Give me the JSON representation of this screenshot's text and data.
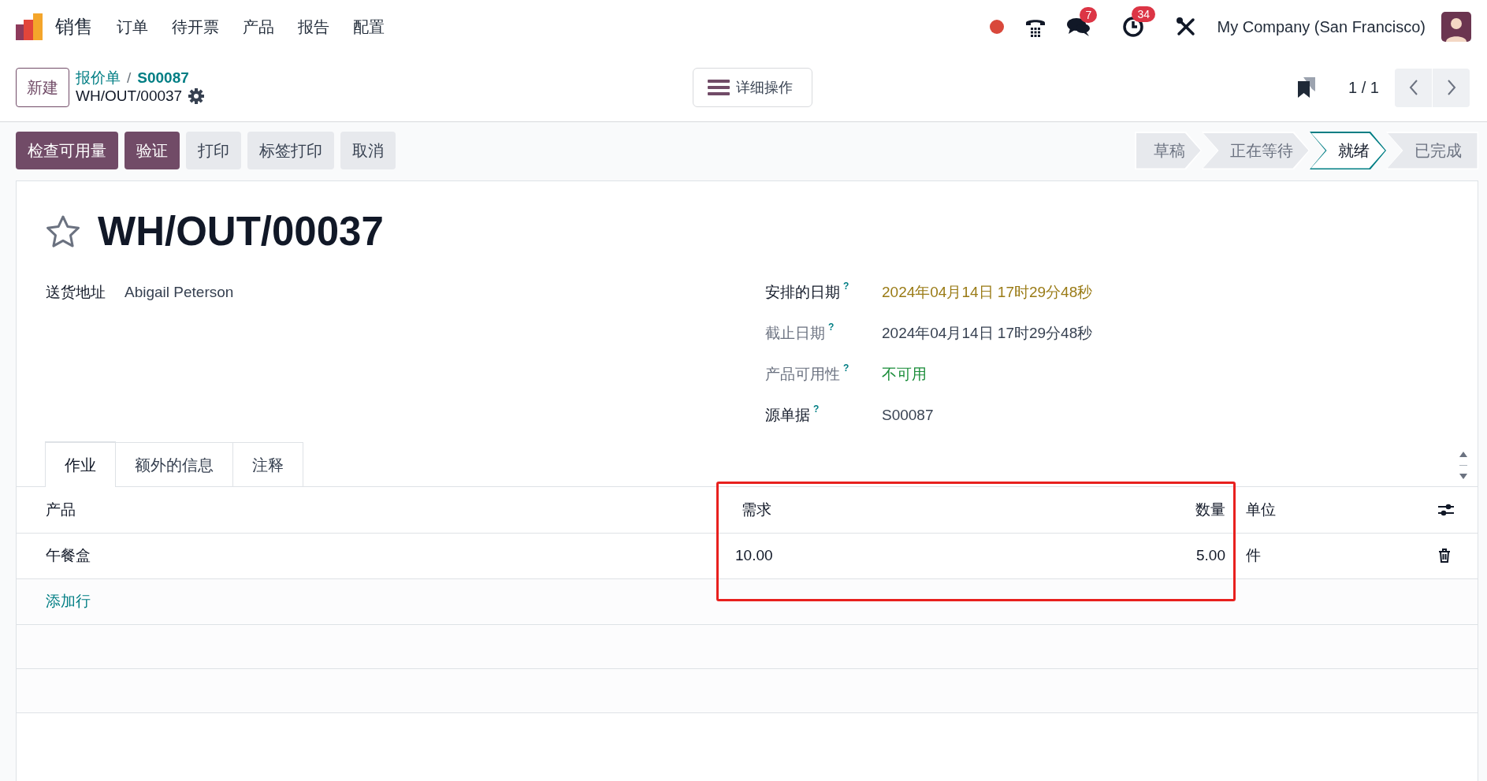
{
  "navbar": {
    "app": "销售",
    "menu": [
      "订单",
      "待开票",
      "产品",
      "报告",
      "配置"
    ],
    "chat_count": "7",
    "activity_count": "34",
    "company": "My Company (San Francisco)"
  },
  "control_panel": {
    "new_button": "新建",
    "breadcrumb": [
      "报价单",
      "S00087"
    ],
    "separator": "/",
    "record": "WH/OUT/00037",
    "actions_button": "详细操作",
    "pager": "1 / 1"
  },
  "buttons": [
    {
      "label": "检查可用量",
      "kind": "primary"
    },
    {
      "label": "验证",
      "kind": "primary"
    },
    {
      "label": "打印",
      "kind": "secondary"
    },
    {
      "label": "标签打印",
      "kind": "secondary"
    },
    {
      "label": "取消",
      "kind": "secondary"
    }
  ],
  "statusbar": [
    {
      "label": "草稿",
      "selected": false
    },
    {
      "label": "正在等待",
      "selected": false
    },
    {
      "label": "就绪",
      "selected": true
    },
    {
      "label": "已完成",
      "selected": false
    }
  ],
  "form": {
    "title": "WH/OUT/00037",
    "starred": false,
    "left_fields": [
      {
        "label": "送货地址",
        "value": "Abigail Peterson"
      }
    ],
    "right_fields": [
      {
        "label": "安排的日期",
        "help": "?",
        "muted": false,
        "value": "2024年04月14日 17时29分48秒",
        "kind": "warning"
      },
      {
        "label": "截止日期",
        "help": "?",
        "muted": true,
        "value": "2024年04月14日 17时29分48秒",
        "kind": "plain"
      },
      {
        "label": "产品可用性",
        "help": "?",
        "muted": true,
        "value": "不可用",
        "kind": "success"
      },
      {
        "label": "源单据",
        "help": "?",
        "muted": false,
        "value": "S00087",
        "kind": "plain"
      }
    ]
  },
  "tabs": [
    {
      "label": "作业",
      "selected": true
    },
    {
      "label": "额外的信息",
      "selected": false
    },
    {
      "label": "注释",
      "selected": false
    }
  ],
  "table": {
    "columns": [
      {
        "label": "产品",
        "highlighted": false
      },
      {
        "label": "需求",
        "highlighted": true
      },
      {
        "label": "数量",
        "highlighted": true
      },
      {
        "label": "单位",
        "highlighted": false
      }
    ],
    "rows": [
      [
        "午餐盒",
        "10.00",
        "5.00",
        "件"
      ]
    ],
    "add_line": "添加行"
  }
}
